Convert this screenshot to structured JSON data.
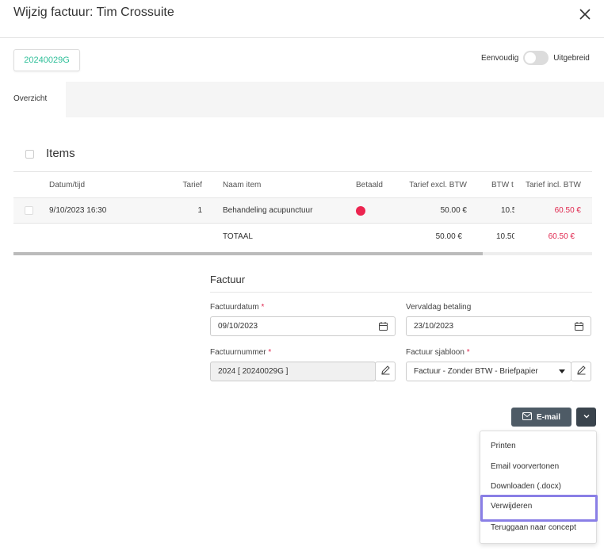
{
  "header": {
    "title": "Wijzig factuur: Tim Crossuite"
  },
  "invoice_code": "20240029G",
  "mode": {
    "left_label": "Eenvoudig",
    "right_label": "Uitgebreid",
    "is_extended": false
  },
  "tabs": {
    "active": "Overzicht"
  },
  "items": {
    "title": "Items",
    "columns": [
      "Datum/tijd",
      "Tarief",
      "Naam item",
      "Betaald",
      "Tarief excl. BTW",
      "BTW t",
      "Tarief incl. BTW"
    ],
    "rows": [
      {
        "datetime": "9/10/2023 16:30",
        "tarief": "1",
        "name": "Behandeling acupunctuur",
        "paid": false,
        "excl": "50.00 €",
        "btw": "10.5",
        "incl": "60.50 €"
      }
    ],
    "total": {
      "label": "TOTAAL",
      "excl": "50.00 €",
      "btw": "10.50",
      "incl": "60.50 €"
    }
  },
  "factuur": {
    "title": "Factuur",
    "factuurdatum_label": "Factuurdatum",
    "factuurdatum_value": "09/10/2023",
    "vervaldag_label": "Vervaldag betaling",
    "vervaldag_value": "23/10/2023",
    "factuurnummer_label": "Factuurnummer",
    "factuurnummer_value": "2024 [ 20240029G ]",
    "sjabloon_label": "Factuur sjabloon",
    "sjabloon_value": "Factuur - Zonder BTW - Briefpapier",
    "required_mark": "*"
  },
  "actions": {
    "email_label": "E-mail",
    "menu": [
      "Printen",
      "Email voorvertonen",
      "Downloaden (.docx)",
      "Verwijderen",
      "Teruggaan naar concept"
    ]
  },
  "colors": {
    "accent_green": "#2dbf98",
    "paid_red": "#ec2550",
    "price_red": "#e0284f",
    "highlight": "#8a7fe6",
    "button_dark": "#4e5b66"
  }
}
